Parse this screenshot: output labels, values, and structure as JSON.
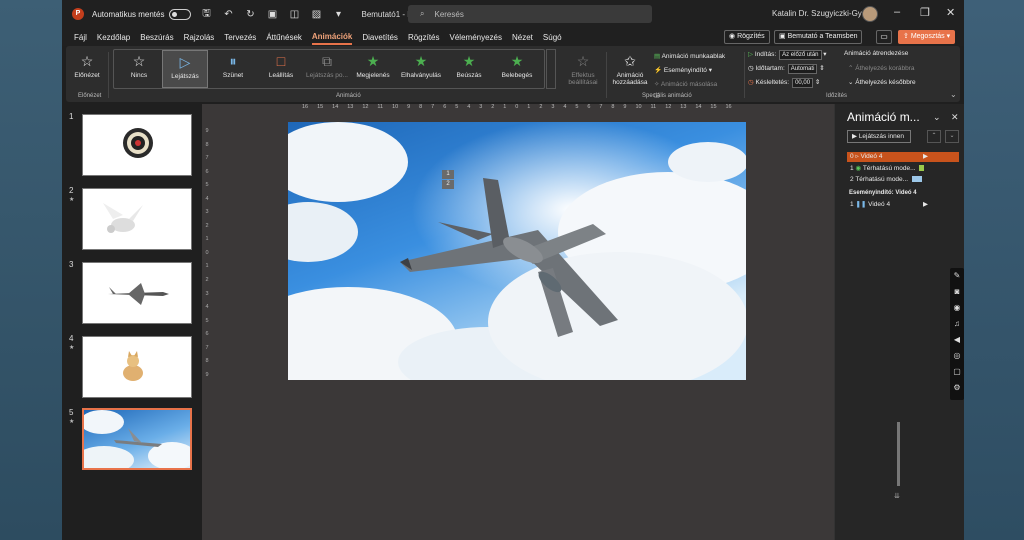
{
  "titlebar": {
    "app_logo": "P",
    "autosave_label": "Automatikus mentés",
    "autosave_state": "off",
    "doc_title": "Bemutató1 - PowerP...",
    "search_placeholder": "Keresés",
    "user_name": "Katalin Dr. Szugyiczki-Györfi"
  },
  "menu": {
    "items": [
      "Fájl",
      "Kezdőlap",
      "Beszúrás",
      "Rajzolás",
      "Tervezés",
      "Áttűnések",
      "Animációk",
      "Diavetítés",
      "Rögzítés",
      "Véleményezés",
      "Nézet",
      "Súgó"
    ],
    "active": "Animációk",
    "rec_label": "Rögzítés",
    "teams_label": "Bemutató a Teamsben",
    "share_label": "Megosztás"
  },
  "ribbon": {
    "preview_label": "Előnézet",
    "preview_group": "Előnézet",
    "animation_group": "Animáció",
    "gallery": [
      {
        "label": "Nincs",
        "icon": "star-outline-icon"
      },
      {
        "label": "Lejátszás",
        "icon": "play-icon",
        "selected": true
      },
      {
        "label": "Szünet",
        "icon": "pause-icon"
      },
      {
        "label": "Leállítás",
        "icon": "stop-icon"
      },
      {
        "label": "Lejátszás po...",
        "icon": "seek-icon",
        "dim": true
      },
      {
        "label": "Megjelenés",
        "icon": "star-icon"
      },
      {
        "label": "Elhalványulás",
        "icon": "star-icon"
      },
      {
        "label": "Beúszás",
        "icon": "star-icon"
      },
      {
        "label": "Belebegés",
        "icon": "star-icon"
      }
    ],
    "effect_options": "Effektus beállításai",
    "add_animation": "Animáció hozzáadása",
    "anim_pane": "Animáció munkaablak",
    "trigger": "Eseményindító",
    "anim_painter": "Animáció másolása",
    "advanced_group": "Speciális animáció",
    "start_label": "Indítás:",
    "start_value": "Az előző után",
    "duration_label": "Időtartam:",
    "duration_value": "Automati",
    "delay_label": "Késleltetés:",
    "delay_value": "00,00",
    "timing_group": "Időzítés",
    "reorder_label": "Animáció átrendezése",
    "move_earlier": "Áthelyezés korábbra",
    "move_later": "Áthelyezés későbbre"
  },
  "thumbnails": [
    {
      "num": "1",
      "star": false,
      "subject": "dartboard"
    },
    {
      "num": "2",
      "star": true,
      "subject": "pegasus"
    },
    {
      "num": "3",
      "star": false,
      "subject": "jet"
    },
    {
      "num": "4",
      "star": true,
      "subject": "cat"
    },
    {
      "num": "5",
      "star": true,
      "subject": "jet-sky",
      "selected": true
    }
  ],
  "ruler": {
    "horizontal": [
      "16",
      "15",
      "14",
      "13",
      "12",
      "11",
      "10",
      "9",
      "8",
      "7",
      "6",
      "5",
      "4",
      "3",
      "2",
      "1",
      "0",
      "1",
      "2",
      "3",
      "4",
      "5",
      "6",
      "7",
      "8",
      "9",
      "10",
      "11",
      "12",
      "13",
      "14",
      "15",
      "16"
    ],
    "vertical": [
      "9",
      "8",
      "7",
      "6",
      "5",
      "4",
      "3",
      "2",
      "1",
      "0",
      "1",
      "2",
      "3",
      "4",
      "5",
      "6",
      "7",
      "8",
      "9"
    ]
  },
  "slide_tags": {
    "top_a": "0",
    "top_b": "?",
    "mid_a": "1",
    "mid_b": "2"
  },
  "anim_panel": {
    "title": "Animáció m...",
    "play_from": "Lejátszás innen",
    "items": [
      {
        "num": "0",
        "label": "Videó 4",
        "selected": true,
        "bar_color": "#e8734a"
      },
      {
        "num": "1",
        "label": "Térhatású mode...",
        "selected": false,
        "bar_color": "#9bc94b"
      },
      {
        "num": "2",
        "label": "Térhatású mode...",
        "selected": false,
        "bar_color": "#9cc7e8"
      }
    ],
    "trigger_header": "Eseményindító: Videó 4",
    "trigger_items": [
      {
        "num": "1",
        "label": "Videó 4"
      }
    ]
  },
  "colors": {
    "accent": "#e8734a",
    "ribbon_bg": "#2d2d2d",
    "canvas_bg": "#3b3838"
  }
}
